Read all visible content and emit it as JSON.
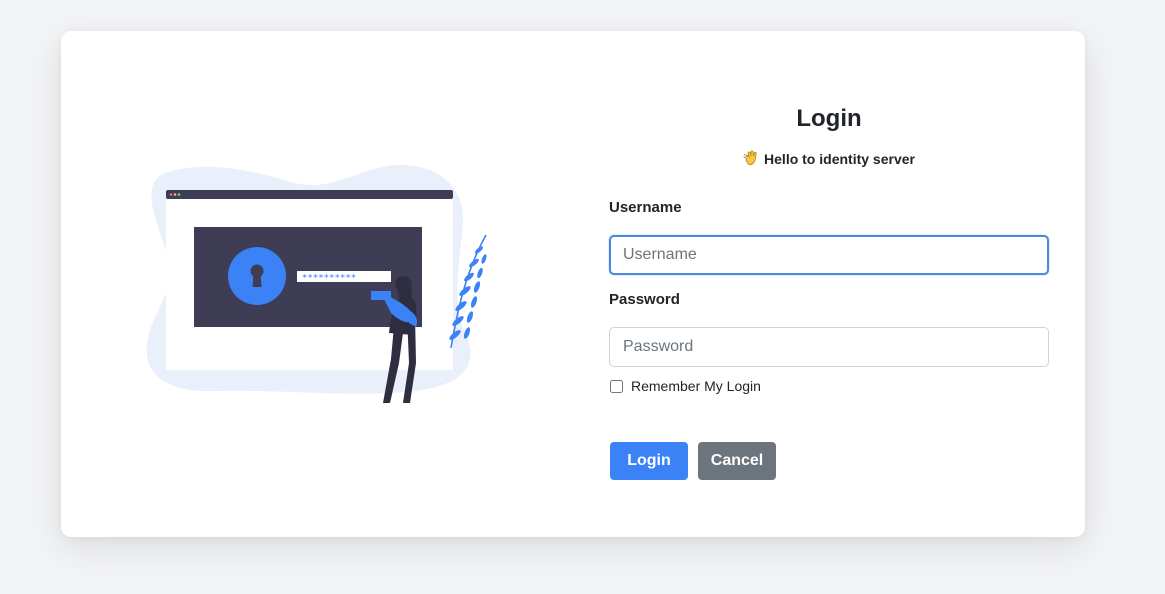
{
  "form": {
    "title": "Login",
    "subtitle_icon": "waving-hand-icon",
    "subtitle": "Hello to identity server",
    "username_label": "Username",
    "username_placeholder": "Username",
    "username_value": "",
    "password_label": "Password",
    "password_placeholder": "Password",
    "password_value": "",
    "remember_label": "Remember My Login",
    "remember_checked": false,
    "login_button": "Login",
    "cancel_button": "Cancel"
  },
  "illustration": {
    "icon": "login-security-illustration",
    "password_mask": "**********"
  },
  "colors": {
    "accent": "#3b82f6",
    "secondary": "#6c757d",
    "focus_border": "#4a89dc",
    "illustration_dark": "#3f3d56",
    "illustration_blob": "#eaf0fb"
  }
}
